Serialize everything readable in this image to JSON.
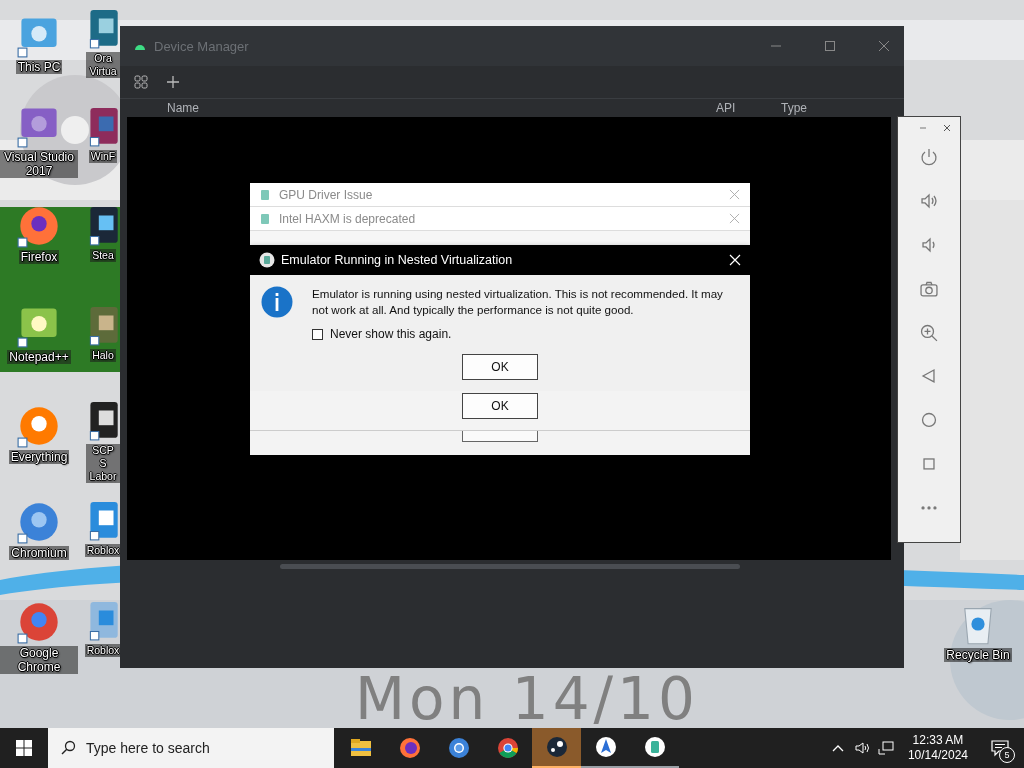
{
  "desktop_icons": [
    {
      "label": "This PC",
      "kind": "pc"
    },
    {
      "label": "Visual Studio 2017",
      "kind": "vs"
    },
    {
      "label": "Firefox",
      "kind": "firefox"
    },
    {
      "label": "Notepad++",
      "kind": "notepad"
    },
    {
      "label": "Everything",
      "kind": "everything"
    },
    {
      "label": "Chromium",
      "kind": "chromium"
    },
    {
      "label": "Google Chrome",
      "kind": "chrome"
    },
    {
      "label": "Ora Virtua",
      "kind": "virtualbox"
    },
    {
      "label": "WinF",
      "kind": "winrar"
    },
    {
      "label": "Stea",
      "kind": "steam"
    },
    {
      "label": "Halo",
      "kind": "halo"
    },
    {
      "label": "SCP S Labor",
      "kind": "scp"
    },
    {
      "label": "Roblox",
      "kind": "roblox"
    },
    {
      "label": "Roblox",
      "kind": "roblox-studio"
    }
  ],
  "recycle_bin": {
    "label": "Recycle Bin"
  },
  "clock_widget": "Mon 14/10",
  "device_manager": {
    "title": "Device Manager",
    "columns": [
      "Name",
      "API",
      "Type"
    ]
  },
  "stacked_dialogs": [
    {
      "title": "GPU Driver Issue"
    },
    {
      "title": "Intel HAXM is deprecated"
    }
  ],
  "dialog": {
    "title": "Emulator Running in Nested Virtualization",
    "message": "Emulator is running using nested virtualization. This is not recommended. It may not work at all. And typically the performance is not quite good.",
    "checkbox": {
      "label": "Never show this again.",
      "checked": false
    },
    "button": "OK"
  },
  "back_dialog_button": "OK",
  "taskbar": {
    "search_placeholder": "Type here to search",
    "apps": [
      {
        "kind": "explorer",
        "selected": false,
        "running": false
      },
      {
        "kind": "firefox",
        "selected": false,
        "running": false
      },
      {
        "kind": "chromium",
        "selected": false,
        "running": false
      },
      {
        "kind": "chrome",
        "selected": false,
        "running": false
      },
      {
        "kind": "steam",
        "selected": true,
        "running": true
      },
      {
        "kind": "studio",
        "selected": false,
        "running": true
      },
      {
        "kind": "emulator",
        "selected": false,
        "running": true
      }
    ],
    "time": "12:33 AM",
    "date": "10/14/2024",
    "notification_count": "5"
  }
}
